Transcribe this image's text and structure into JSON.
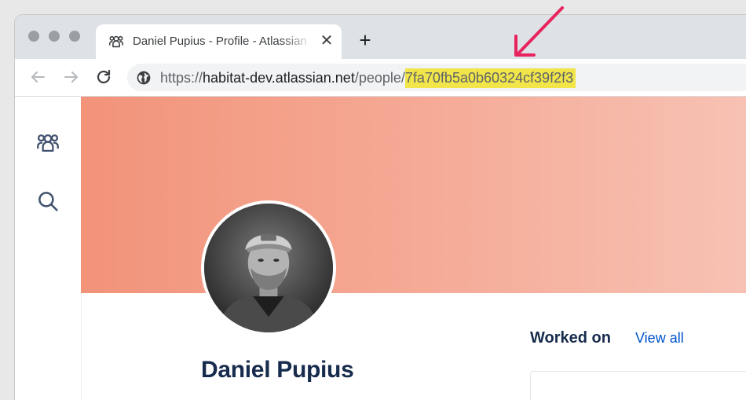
{
  "browser": {
    "tab": {
      "icon": "people-icon",
      "title": "Daniel Pupius - Profile - Atlassian",
      "close_label": "✕"
    },
    "new_tab_label": "+",
    "address_bar": {
      "scheme": "https://",
      "host": "habitat-dev.atlassian.net",
      "path": "/people/",
      "highlighted_id": "7fa70fb5a0b60324cf39f2f3",
      "highlight_color": "#f1e54a"
    }
  },
  "sidebar": {
    "items": [
      {
        "icon": "people-icon"
      },
      {
        "icon": "search-icon"
      }
    ]
  },
  "profile": {
    "name": "Daniel Pupius",
    "cover_colors": [
      "#f2937a",
      "#f7c2b4"
    ],
    "avatar": "profile-photo"
  },
  "worked_on": {
    "heading": "Worked on",
    "view_all_label": "View all"
  },
  "annotation": {
    "arrow_color": "#e8245e"
  }
}
